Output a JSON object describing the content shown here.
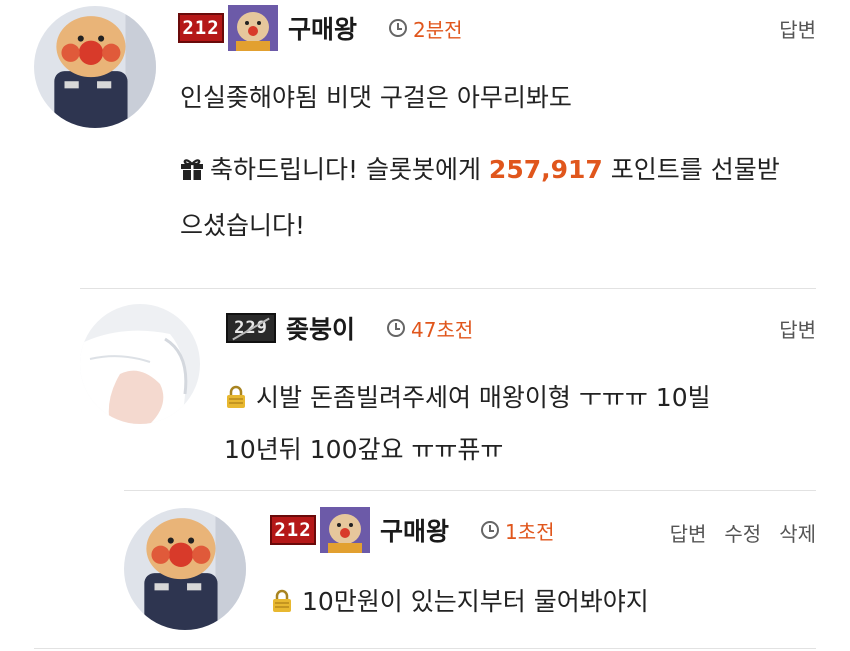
{
  "comments": [
    {
      "level_badge": "212",
      "nickname": "구매왕",
      "time": "2분전",
      "text": "인실좆해야됨 비댓 구걸은 아무리봐도",
      "gift_prefix": "축하드립니다! 슬롯봇에게 ",
      "gift_points": "257,917",
      "gift_suffix": " 포인트를 선물받으셨습니다!",
      "actions": [
        "답변"
      ]
    },
    {
      "level_badge": "229",
      "nickname": "좆붕이",
      "time": "47초전",
      "text_line1": "시발 돈좀빌려주세여 매왕이형 ㅜㅠㅠ 10빌",
      "text_line2": "10년뒤 100갚요 ㅠㅠ퓨ㅠ",
      "actions": [
        "답변"
      ]
    },
    {
      "level_badge": "212",
      "nickname": "구매왕",
      "time": "1초전",
      "text": "10만원이 있는지부터 물어봐야지",
      "actions": [
        "답변",
        "수정",
        "삭제"
      ]
    }
  ],
  "colors": {
    "accent": "#e0561c",
    "badge_red": "#b51818",
    "divider": "#e2e2e2"
  },
  "icons": [
    "clock-icon",
    "gift-icon",
    "lock-icon"
  ]
}
